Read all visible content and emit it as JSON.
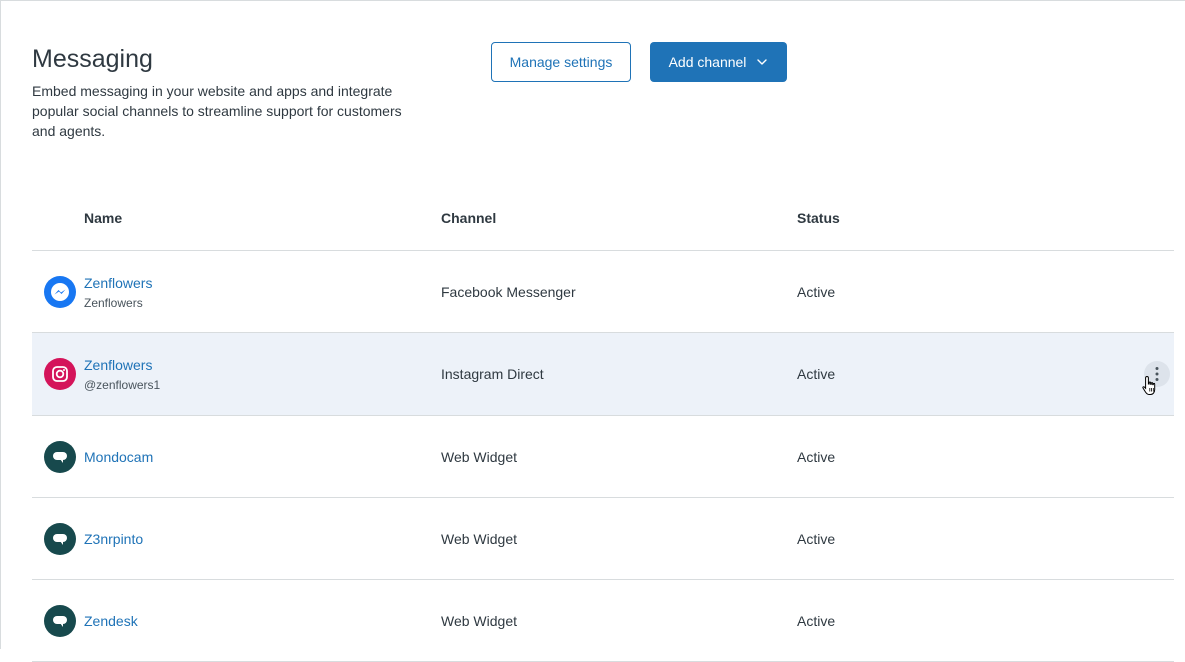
{
  "header": {
    "title": "Messaging",
    "description": "Embed messaging in your website and apps and integrate popular social channels to streamline support for customers and agents."
  },
  "actions": {
    "manage_settings_label": "Manage settings",
    "add_channel_label": "Add channel"
  },
  "table": {
    "columns": [
      "Name",
      "Channel",
      "Status"
    ],
    "rows": [
      {
        "name": "Zenflowers",
        "sub": "Zenflowers",
        "channel": "Facebook Messenger",
        "status": "Active",
        "icon": "messenger-icon"
      },
      {
        "name": "Zenflowers",
        "sub": "@zenflowers1",
        "channel": "Instagram Direct",
        "status": "Active",
        "icon": "instagram-icon"
      },
      {
        "name": "Mondocam",
        "sub": "",
        "channel": "Web Widget",
        "status": "Active",
        "icon": "web-widget-icon"
      },
      {
        "name": "Z3nrpinto",
        "sub": "",
        "channel": "Web Widget",
        "status": "Active",
        "icon": "web-widget-icon"
      },
      {
        "name": "Zendesk",
        "sub": "",
        "channel": "Web Widget",
        "status": "Active",
        "icon": "web-widget-icon"
      }
    ]
  },
  "colors": {
    "accent": "#1f73b7",
    "messenger": "#1877f2",
    "instagram": "#d4145a",
    "web_widget": "#17494d",
    "row_hover": "#edf2f9"
  }
}
